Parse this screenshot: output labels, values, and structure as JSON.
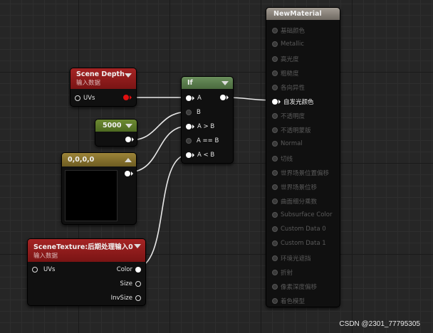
{
  "nodes": {
    "scene_depth": {
      "title": "Scene Depth",
      "subtitle": "输入数据",
      "pin_uvs": "UVs"
    },
    "constant": {
      "value": "5000"
    },
    "color_const": {
      "title": "0,0,0,0",
      "swatch_color": "#000000"
    },
    "scene_texture": {
      "title": "SceneTexture:后期处理输入0",
      "subtitle": "输入数据",
      "pin_uvs": "UVs",
      "out_color": "Color",
      "out_size": "Size",
      "out_invsize": "InvSize"
    },
    "if_node": {
      "title": "If",
      "pins": {
        "a": "A",
        "b": "B",
        "a_gt_b": "A > B",
        "a_eq_b": "A == B",
        "a_lt_b": "A < B"
      }
    },
    "material": {
      "title": "NewMaterial",
      "pins": [
        "基础颜色",
        "Metallic",
        "高光度",
        "粗糙度",
        "各向异性",
        "自发光颜色",
        "不透明度",
        "不透明蒙版",
        "Normal",
        "切线",
        "世界场景位置偏移",
        "世界场景位移",
        "曲面细分乘数",
        "Subsurface Color",
        "Custom Data 0",
        "Custom Data 1",
        "环境光遮挡",
        "折射",
        "像素深度偏移",
        "着色模型"
      ]
    }
  },
  "colors": {
    "scene_depth_header": "#8e1a1a",
    "scene_texture_header": "#8e1a1a",
    "if_header": "#5c7f4f",
    "constant_header": "#5f7a2c",
    "color_const_header": "#8a7530",
    "material_header": "#8d867e"
  },
  "watermark": "CSDN @2301_77795305"
}
